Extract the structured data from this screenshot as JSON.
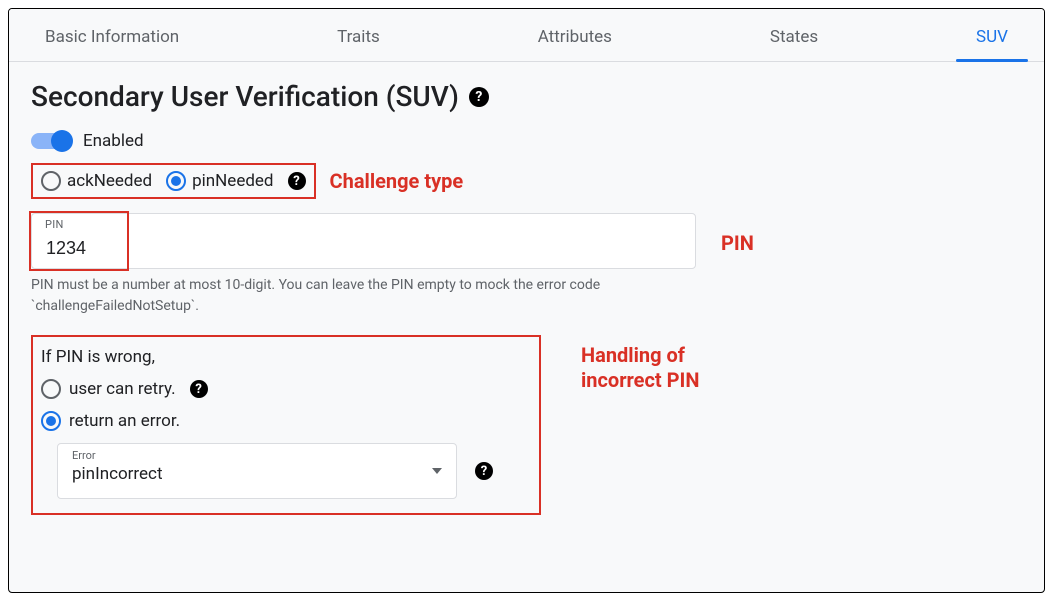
{
  "tabs": {
    "items": [
      {
        "label": "Basic Information",
        "active": false
      },
      {
        "label": "Traits",
        "active": false
      },
      {
        "label": "Attributes",
        "active": false
      },
      {
        "label": "States",
        "active": false
      },
      {
        "label": "SUV",
        "active": true
      }
    ]
  },
  "page": {
    "title": "Secondary User Verification (SUV)"
  },
  "toggle": {
    "enabled": true,
    "label": "Enabled"
  },
  "challenge": {
    "options": {
      "ack": "ackNeeded",
      "pin": "pinNeeded"
    },
    "selected": "pinNeeded"
  },
  "pin": {
    "floating_label": "PIN",
    "value": "1234",
    "helper": "PIN must be a number at most 10-digit. You can leave the PIN empty to mock the error code `challengeFailedNotSetup`."
  },
  "wrong_pin": {
    "prompt": "If PIN is wrong,",
    "options": {
      "retry": "user can retry.",
      "error": "return an error."
    },
    "selected": "error",
    "error_select": {
      "floating_label": "Error",
      "value": "pinIncorrect"
    }
  },
  "annotations": {
    "challenge": "Challenge type",
    "pin": "PIN",
    "handling": "Handling of\nincorrect PIN"
  }
}
